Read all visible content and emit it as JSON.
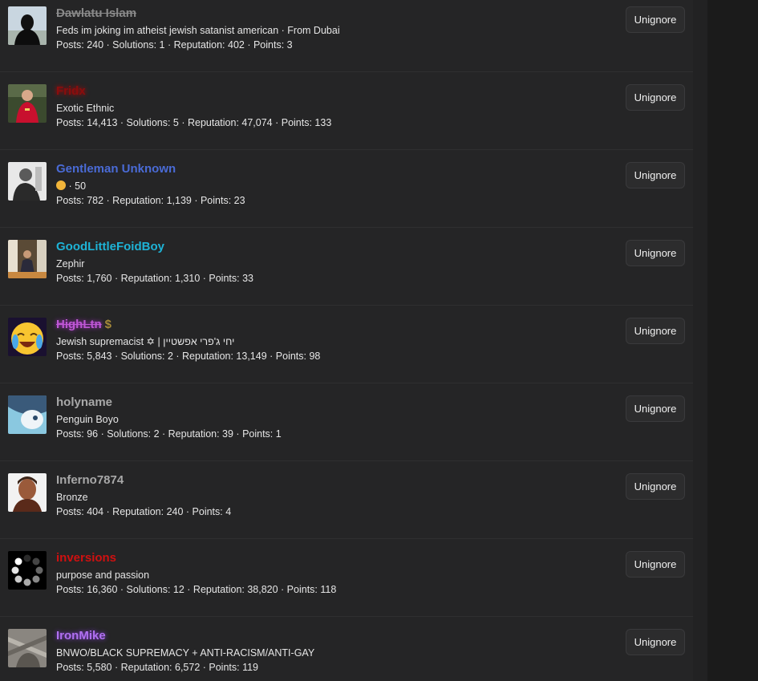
{
  "button_label": "Unignore",
  "users": [
    {
      "name": "Dawlatu Islam",
      "title": "Feds im joking im atheist jewish satanist american · From Dubai",
      "stats": "Posts: 240 · Solutions: 1 · Reputation: 402 · Points: 3"
    },
    {
      "name": "Fridx",
      "title": "Exotic Ethnic",
      "stats": "Posts: 14,413 · Solutions: 5 · Reputation: 47,074 · Points: 133"
    },
    {
      "name": "Gentleman Unknown",
      "title": "· 50",
      "stats": "Posts: 782 · Reputation: 1,139 · Points: 23"
    },
    {
      "name": "GoodLittleFoidBoy",
      "title": "Zephir",
      "stats": "Posts: 1,760 · Reputation: 1,310 · Points: 33"
    },
    {
      "name": "HighLtn",
      "badge": "$",
      "title": "Jewish supremacist ✡ | יחי ג'פרי אפשטיין",
      "stats": "Posts: 5,843 · Solutions: 2 · Reputation: 13,149 · Points: 98"
    },
    {
      "name": "holyname",
      "title": "Penguin Boyo",
      "stats": "Posts: 96 · Solutions: 2 · Reputation: 39 · Points: 1"
    },
    {
      "name": "Inferno7874",
      "title": "Bronze",
      "stats": "Posts: 404 · Reputation: 240 · Points: 4"
    },
    {
      "name": "inversions",
      "title": "purpose and passion",
      "stats": "Posts: 16,360 · Solutions: 12 · Reputation: 38,820 · Points: 118"
    },
    {
      "name": "IronMike",
      "title": "BNWO/BLACK SUPREMACY + ANTI-RACISM/ANTI-GAY",
      "stats": "Posts: 5,580 · Reputation: 6,572 · Points: 119"
    }
  ],
  "colors": {
    "list_background": "#252526",
    "button_background": "#2c2c2d",
    "name_blue": "#4a6bd6",
    "name_cyan": "#1eb3d6",
    "name_red": "#d01010",
    "name_violet": "#b070f0"
  }
}
